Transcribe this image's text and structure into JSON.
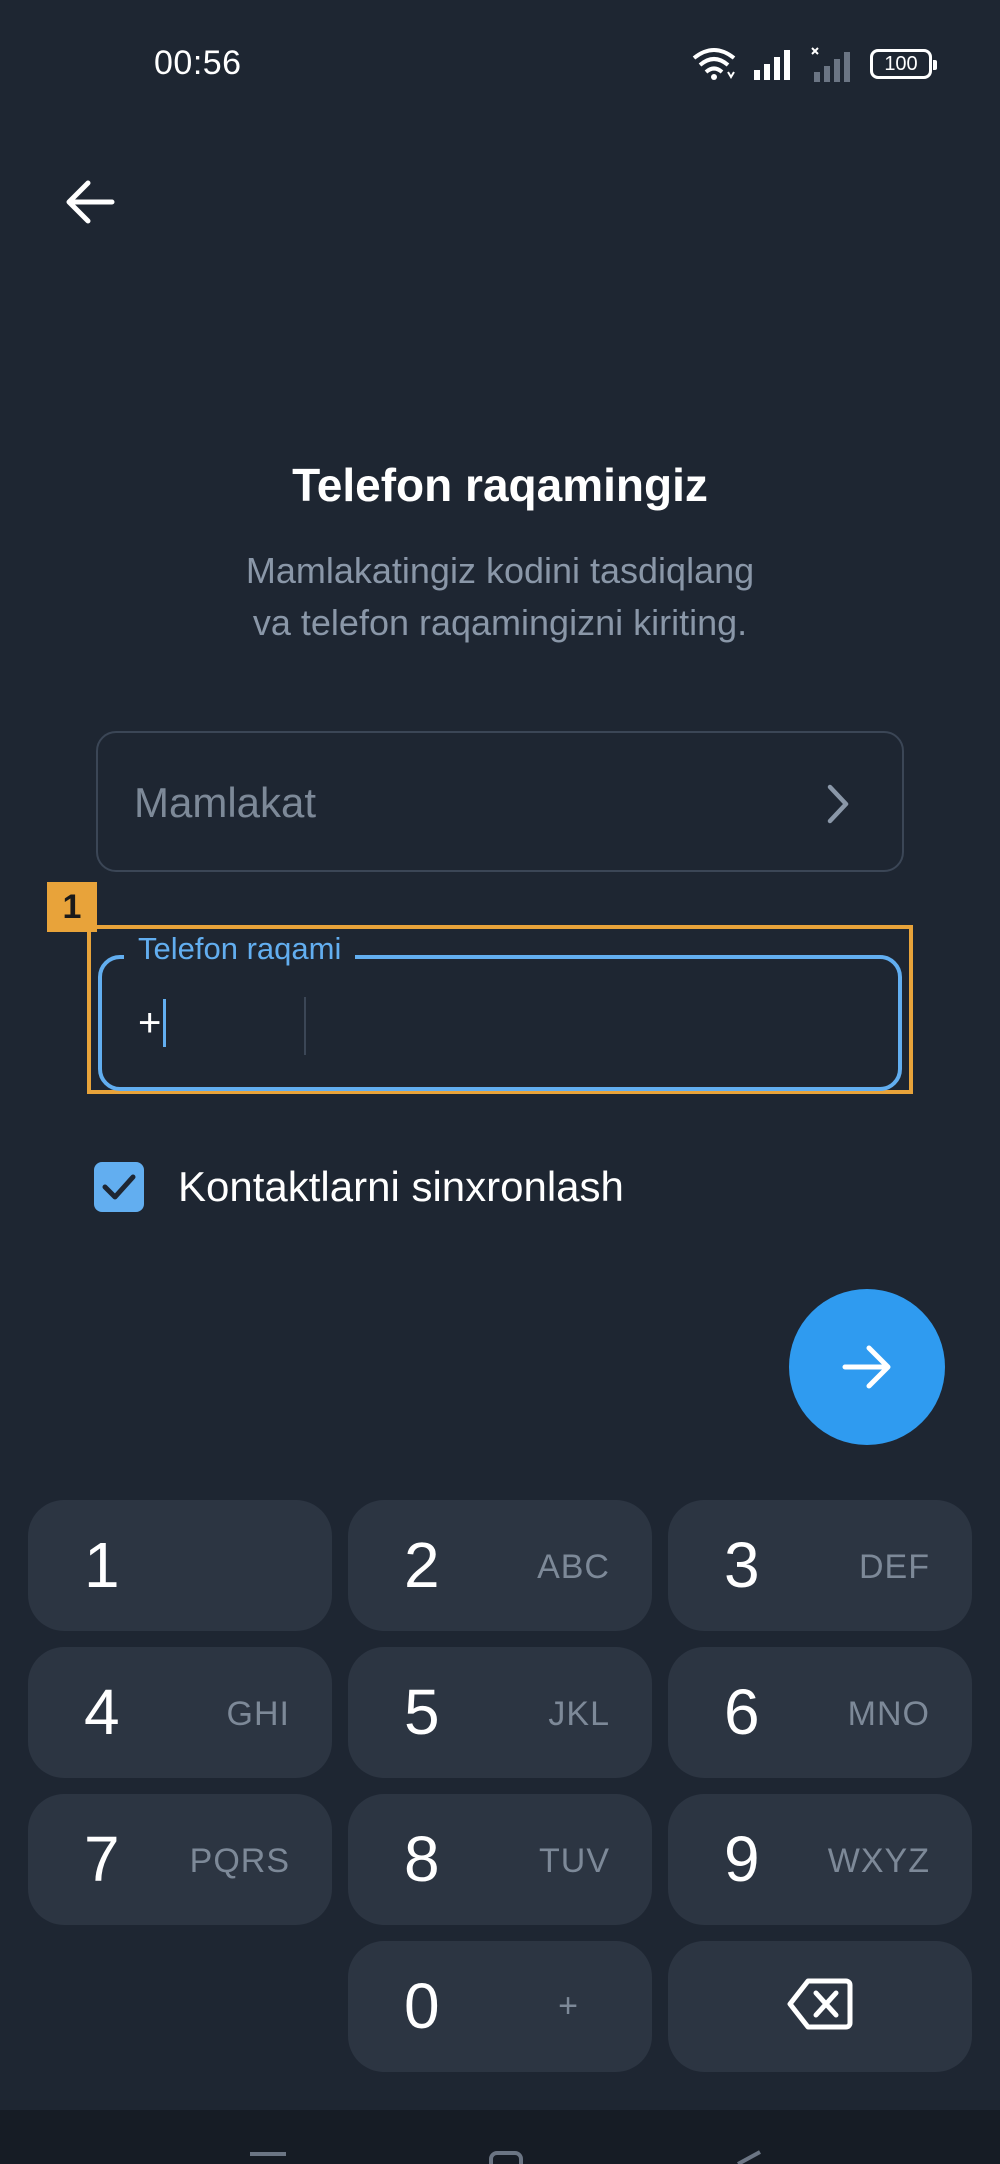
{
  "status_bar": {
    "time": "00:56",
    "battery": "100",
    "icons": [
      "wifi-icon",
      "signal-icon",
      "signal-no-sim-icon",
      "battery-icon"
    ]
  },
  "header": {
    "back_icon": "arrow-left-icon"
  },
  "main": {
    "title": "Telefon raqamingiz",
    "subtitle_line1": "Mamlakatingiz kodini tasdiqlang",
    "subtitle_line2": "va telefon raqamingizni kiriting."
  },
  "country_field": {
    "label": "Mamlakat",
    "icon": "chevron-right-icon"
  },
  "phone_field": {
    "label": "Telefon raqami",
    "prefix": "+",
    "value": "",
    "highlight_badge": "1"
  },
  "sync_contacts": {
    "label": "Kontaktlarni sinxronlash",
    "checked": true
  },
  "next_button": {
    "icon": "arrow-right-icon"
  },
  "keypad": {
    "keys": [
      {
        "num": "1",
        "letters": ""
      },
      {
        "num": "2",
        "letters": "ABC"
      },
      {
        "num": "3",
        "letters": "DEF"
      },
      {
        "num": "4",
        "letters": "GHI"
      },
      {
        "num": "5",
        "letters": "JKL"
      },
      {
        "num": "6",
        "letters": "MNO"
      },
      {
        "num": "7",
        "letters": "PQRS"
      },
      {
        "num": "8",
        "letters": "TUV"
      },
      {
        "num": "9",
        "letters": "WXYZ"
      },
      {
        "num": "0",
        "letters": "+"
      }
    ],
    "backspace_icon": "backspace-icon"
  },
  "colors": {
    "background": "#1e2632",
    "accent": "#2f9bf0",
    "field_focus": "#62aef0",
    "key_bg": "#2c3542",
    "highlight": "#e8a33a"
  }
}
